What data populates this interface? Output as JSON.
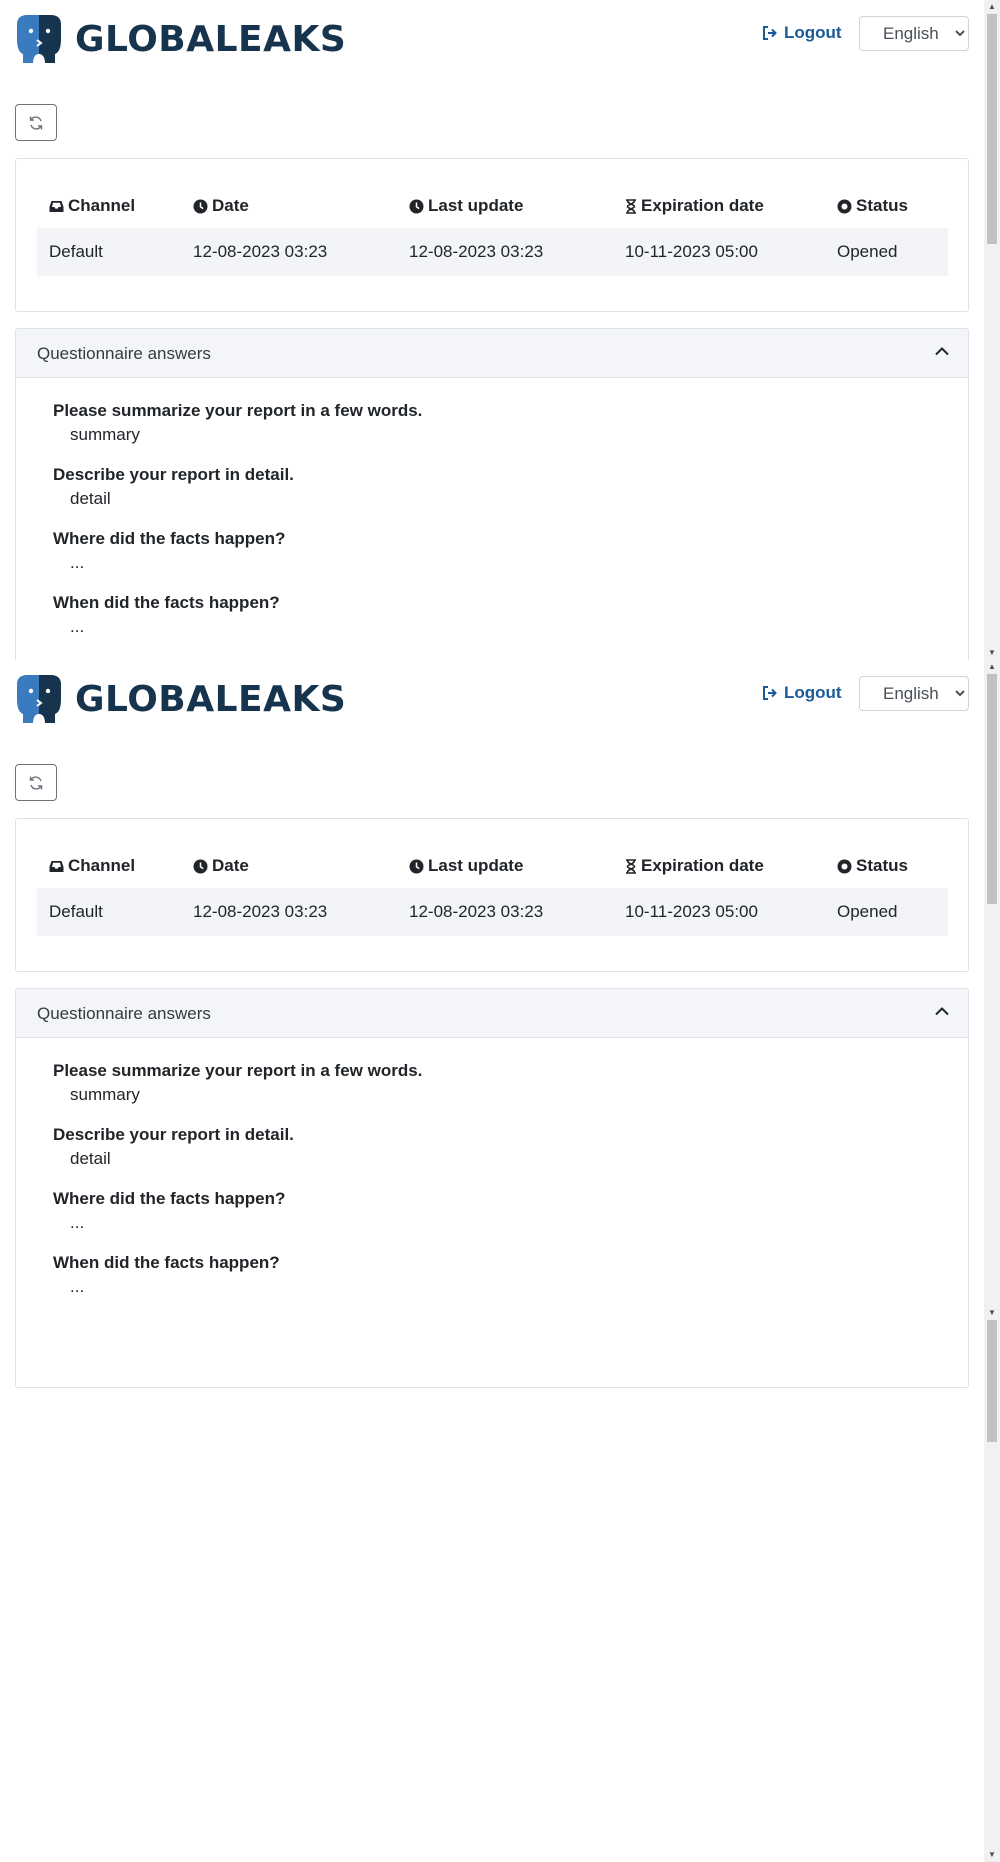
{
  "header": {
    "brand": "GLOBALEAKS",
    "logout_label": "Logout",
    "language": {
      "selected": "English",
      "options": [
        "English"
      ]
    }
  },
  "report_table": {
    "columns": [
      {
        "label": "Channel",
        "icon": "inbox-icon"
      },
      {
        "label": "Date",
        "icon": "clock-icon"
      },
      {
        "label": "Last update",
        "icon": "clock-icon"
      },
      {
        "label": "Expiration date",
        "icon": "hourglass-icon"
      },
      {
        "label": "Status",
        "icon": "dot-circle-icon"
      }
    ],
    "row": {
      "channel": "Default",
      "date": "12-08-2023 03:23",
      "last_update": "12-08-2023 03:23",
      "expiration_date": "10-11-2023 05:00",
      "status": "Opened"
    }
  },
  "questionnaire": {
    "title": "Questionnaire answers",
    "items": [
      {
        "question": "Please summarize your report in a few words.",
        "answer": "summary"
      },
      {
        "question": "Describe your report in detail.",
        "answer": "detail"
      },
      {
        "question": "Where did the facts happen?",
        "answer": "..."
      },
      {
        "question": "When did the facts happen?",
        "answer": "..."
      }
    ]
  },
  "colors": {
    "brand_dark": "#17344f",
    "brand_blue": "#3a7bbf",
    "link": "#1a5a96",
    "row_bg": "#f2f4f7"
  }
}
